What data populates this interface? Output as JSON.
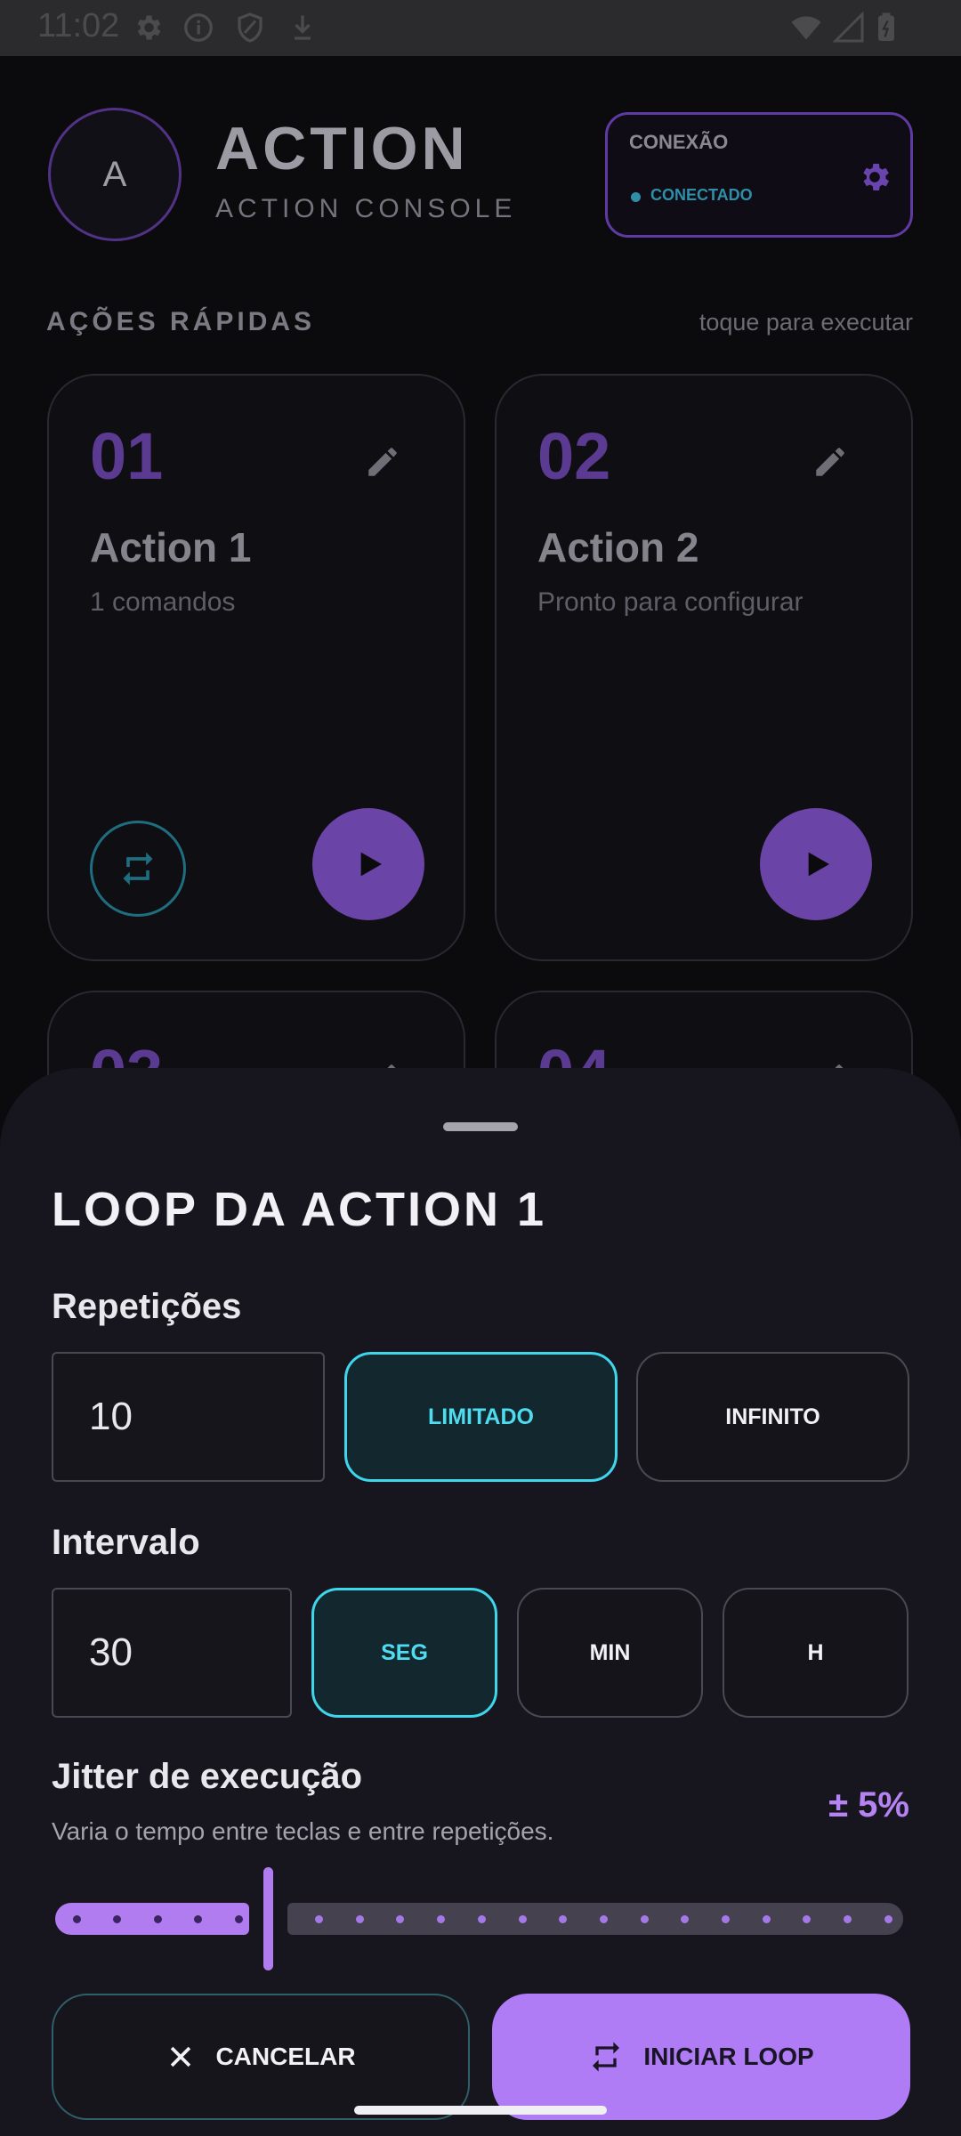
{
  "status_bar": {
    "time": "11:02",
    "icons": [
      "gear-icon",
      "info-icon",
      "shield-icon",
      "download-icon",
      "wifi-icon",
      "signal-icon",
      "battery-icon"
    ]
  },
  "header": {
    "avatar_letter": "A",
    "title": "ACTION",
    "subtitle": "ACTION CONSOLE",
    "connection": {
      "label": "CONEXÃO",
      "status": "CONECTADO",
      "status_color": "#2f8fa8"
    }
  },
  "quick_actions": {
    "label": "AÇÕES RÁPIDAS",
    "hint": "toque para executar",
    "cards": [
      {
        "number": "01",
        "title": "Action 1",
        "subtitle": "1 comandos"
      },
      {
        "number": "02",
        "title": "Action 2",
        "subtitle": "Pronto para configurar"
      },
      {
        "number": "03"
      },
      {
        "number": "04"
      }
    ]
  },
  "sheet": {
    "title": "LOOP DA ACTION 1",
    "repetitions": {
      "label": "Repetições",
      "value": "10",
      "options": [
        "LIMITADO",
        "INFINITO"
      ],
      "selected": "LIMITADO"
    },
    "interval": {
      "label": "Intervalo",
      "value": "30",
      "options": [
        "SEG",
        "MIN",
        "H"
      ],
      "selected": "SEG"
    },
    "jitter": {
      "title": "Jitter de execução",
      "description": "Varia o tempo entre teclas e entre repetições.",
      "value_label": "± 5%",
      "fraction": 0.25
    },
    "buttons": {
      "cancel": "CANCELAR",
      "start": "INICIAR LOOP"
    }
  },
  "colors": {
    "accent": "#b07cf6",
    "selected": "#3fd6ec",
    "background": "#0b0b0e",
    "sheet": "#17161f"
  }
}
